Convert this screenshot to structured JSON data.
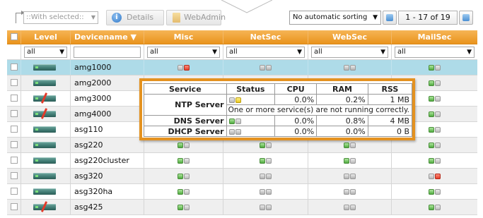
{
  "toolbar": {
    "with_selected": "::With selected::",
    "details_label": "Details",
    "webadmin_label": "WebAdmin",
    "sorting_value": "No automatic sorting",
    "pagination": "1 - 17 of 19"
  },
  "columns": {
    "level": "Level",
    "devicename": "Devicename ▼",
    "misc": "Misc",
    "netsec": "NetSec",
    "websec": "WebSec",
    "mailsec": "MailSec"
  },
  "filters": {
    "level": "all",
    "devicename": "",
    "misc": "all",
    "netsec": "all",
    "websec": "all",
    "mailsec": "all"
  },
  "rows": [
    {
      "name": "amg1000",
      "level": "ok",
      "misc": "err",
      "netsec": "off",
      "websec": "off",
      "mailsec": "ok"
    },
    {
      "name": "amg2000",
      "level": "ok",
      "misc": "off",
      "netsec": "off",
      "websec": "off",
      "mailsec": "ok"
    },
    {
      "name": "amg3000",
      "level": "err",
      "misc": "off",
      "netsec": "off",
      "websec": "off",
      "mailsec": "ok"
    },
    {
      "name": "amg4000",
      "level": "err",
      "misc": "off",
      "netsec": "off",
      "websec": "off",
      "mailsec": "ok"
    },
    {
      "name": "asg110",
      "level": "ok",
      "misc": "off",
      "netsec": "off",
      "websec": "off",
      "mailsec": "ok"
    },
    {
      "name": "asg220",
      "level": "ok",
      "misc": "ok",
      "netsec": "ok",
      "websec": "ok",
      "mailsec": "ok"
    },
    {
      "name": "asg220cluster",
      "level": "ok",
      "misc": "ok",
      "netsec": "ok",
      "websec": "ok",
      "mailsec": "ok"
    },
    {
      "name": "asg320",
      "level": "ok",
      "misc": "ok",
      "netsec": "off",
      "websec": "off",
      "mailsec": "err"
    },
    {
      "name": "asg320ha",
      "level": "ok",
      "misc": "ok",
      "netsec": "off",
      "websec": "off",
      "mailsec": "ok"
    },
    {
      "name": "asg425",
      "level": "err",
      "misc": "ok",
      "netsec": "off",
      "websec": "off",
      "mailsec": "ok"
    }
  ],
  "popup": {
    "headers": {
      "service": "Service",
      "status": "Status",
      "cpu": "CPU",
      "ram": "RAM",
      "rss": "RSS"
    },
    "services": [
      {
        "name": "NTP Server",
        "status": "warn",
        "cpu": "0.0%",
        "ram": "0.2%",
        "rss": "1 MB",
        "note": "One or more service(s) are not running correctly."
      },
      {
        "name": "DNS Server",
        "status": "ok",
        "cpu": "0.0%",
        "ram": "0.8%",
        "rss": "4 MB"
      },
      {
        "name": "DHCP Server",
        "status": "off",
        "cpu": "0.0%",
        "ram": "0.0%",
        "rss": "0 B"
      }
    ]
  },
  "status_colors": {
    "ok": "#3fa22e",
    "err": "#e0321e",
    "warn": "#e9c40e",
    "off": "#a9a9a9"
  },
  "accent_color": "#e9931c"
}
